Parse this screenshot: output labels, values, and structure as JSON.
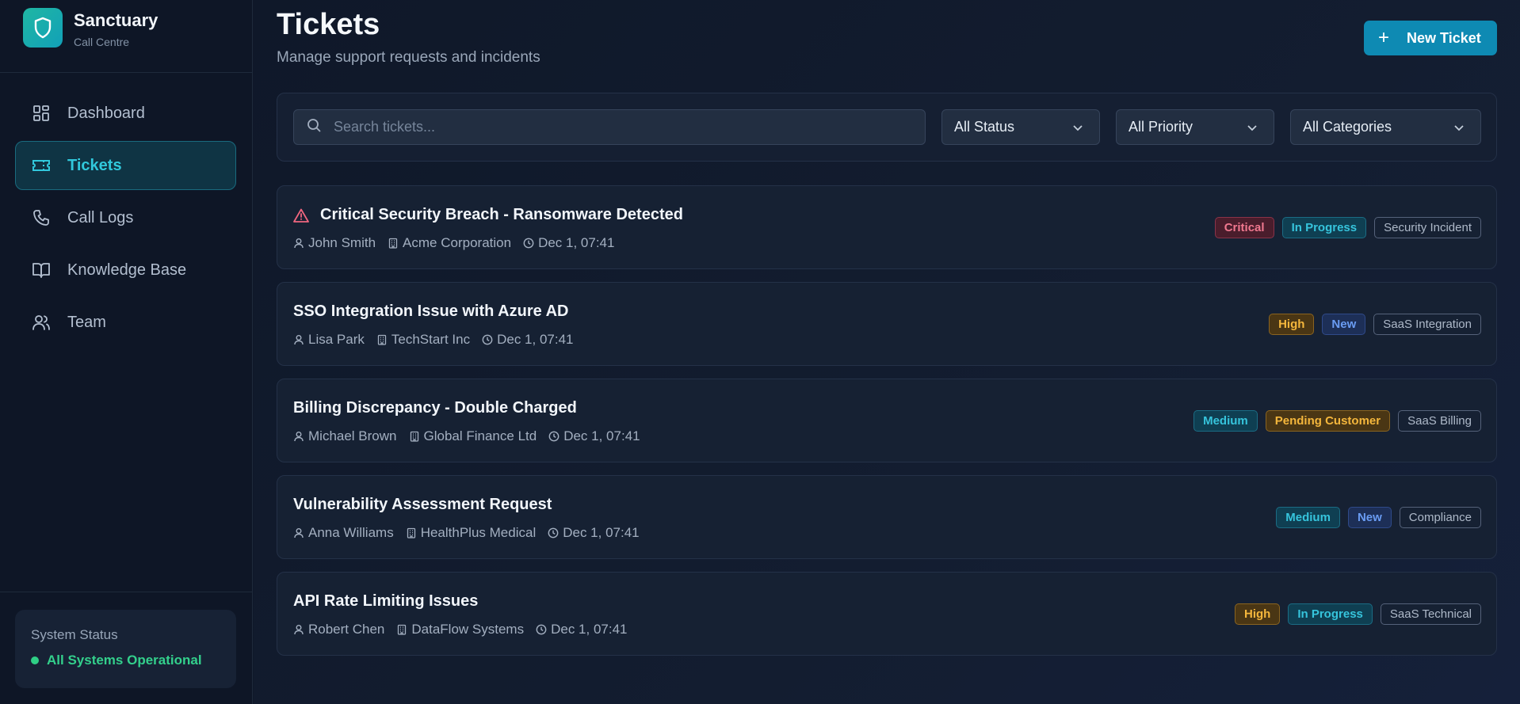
{
  "brand": {
    "title": "Sanctuary",
    "subtitle": "Call Centre"
  },
  "nav": [
    {
      "label": "Dashboard",
      "icon": "dashboard-icon",
      "active": false
    },
    {
      "label": "Tickets",
      "icon": "ticket-icon",
      "active": true
    },
    {
      "label": "Call Logs",
      "icon": "phone-icon",
      "active": false
    },
    {
      "label": "Knowledge Base",
      "icon": "book-icon",
      "active": false
    },
    {
      "label": "Team",
      "icon": "users-icon",
      "active": false
    }
  ],
  "system_status": {
    "title": "System Status",
    "text": "All Systems Operational",
    "color": "#33d08c"
  },
  "header": {
    "title": "Tickets",
    "subtitle": "Manage support requests and incidents",
    "new_button": "New Ticket"
  },
  "filters": {
    "search_placeholder": "Search tickets...",
    "status": "All Status",
    "priority": "All Priority",
    "category": "All Categories"
  },
  "tickets": [
    {
      "title": "Critical Security Breach - Ransomware Detected",
      "alert": true,
      "assignee": "John Smith",
      "company": "Acme Corporation",
      "time": "Dec 1, 07:41",
      "priority": "Critical",
      "status": "In Progress",
      "category": "Security Incident"
    },
    {
      "title": "SSO Integration Issue with Azure AD",
      "alert": false,
      "assignee": "Lisa Park",
      "company": "TechStart Inc",
      "time": "Dec 1, 07:41",
      "priority": "High",
      "status": "New",
      "category": "SaaS Integration"
    },
    {
      "title": "Billing Discrepancy - Double Charged",
      "alert": false,
      "assignee": "Michael Brown",
      "company": "Global Finance Ltd",
      "time": "Dec 1, 07:41",
      "priority": "Medium",
      "status": "Pending Customer",
      "category": "SaaS Billing"
    },
    {
      "title": "Vulnerability Assessment Request",
      "alert": false,
      "assignee": "Anna Williams",
      "company": "HealthPlus Medical",
      "time": "Dec 1, 07:41",
      "priority": "Medium",
      "status": "New",
      "category": "Compliance"
    },
    {
      "title": "API Rate Limiting Issues",
      "alert": false,
      "assignee": "Robert Chen",
      "company": "DataFlow Systems",
      "time": "Dec 1, 07:41",
      "priority": "High",
      "status": "In Progress",
      "category": "SaaS Technical"
    }
  ],
  "badge_colors": {
    "Critical": {
      "bg": "#4a1d2c",
      "border": "#8a3349",
      "fg": "#f0788f"
    },
    "High": {
      "bg": "#4a3614",
      "border": "#8a6420",
      "fg": "#f4b63c"
    },
    "Medium": {
      "bg": "#0f3f52",
      "border": "#1b6c84",
      "fg": "#36c4dc"
    },
    "New": {
      "bg": "#1d2f57",
      "border": "#2f4a8a",
      "fg": "#6a9cf3"
    },
    "In Progress": {
      "bg": "#0f3f52",
      "border": "#1b6c84",
      "fg": "#36c4dc"
    },
    "Pending Customer": {
      "bg": "#4a3614",
      "border": "#8a6420",
      "fg": "#f4b63c"
    },
    "category": {
      "bg": "transparent",
      "border": "#55627a",
      "fg": "#aeb9c9"
    }
  }
}
